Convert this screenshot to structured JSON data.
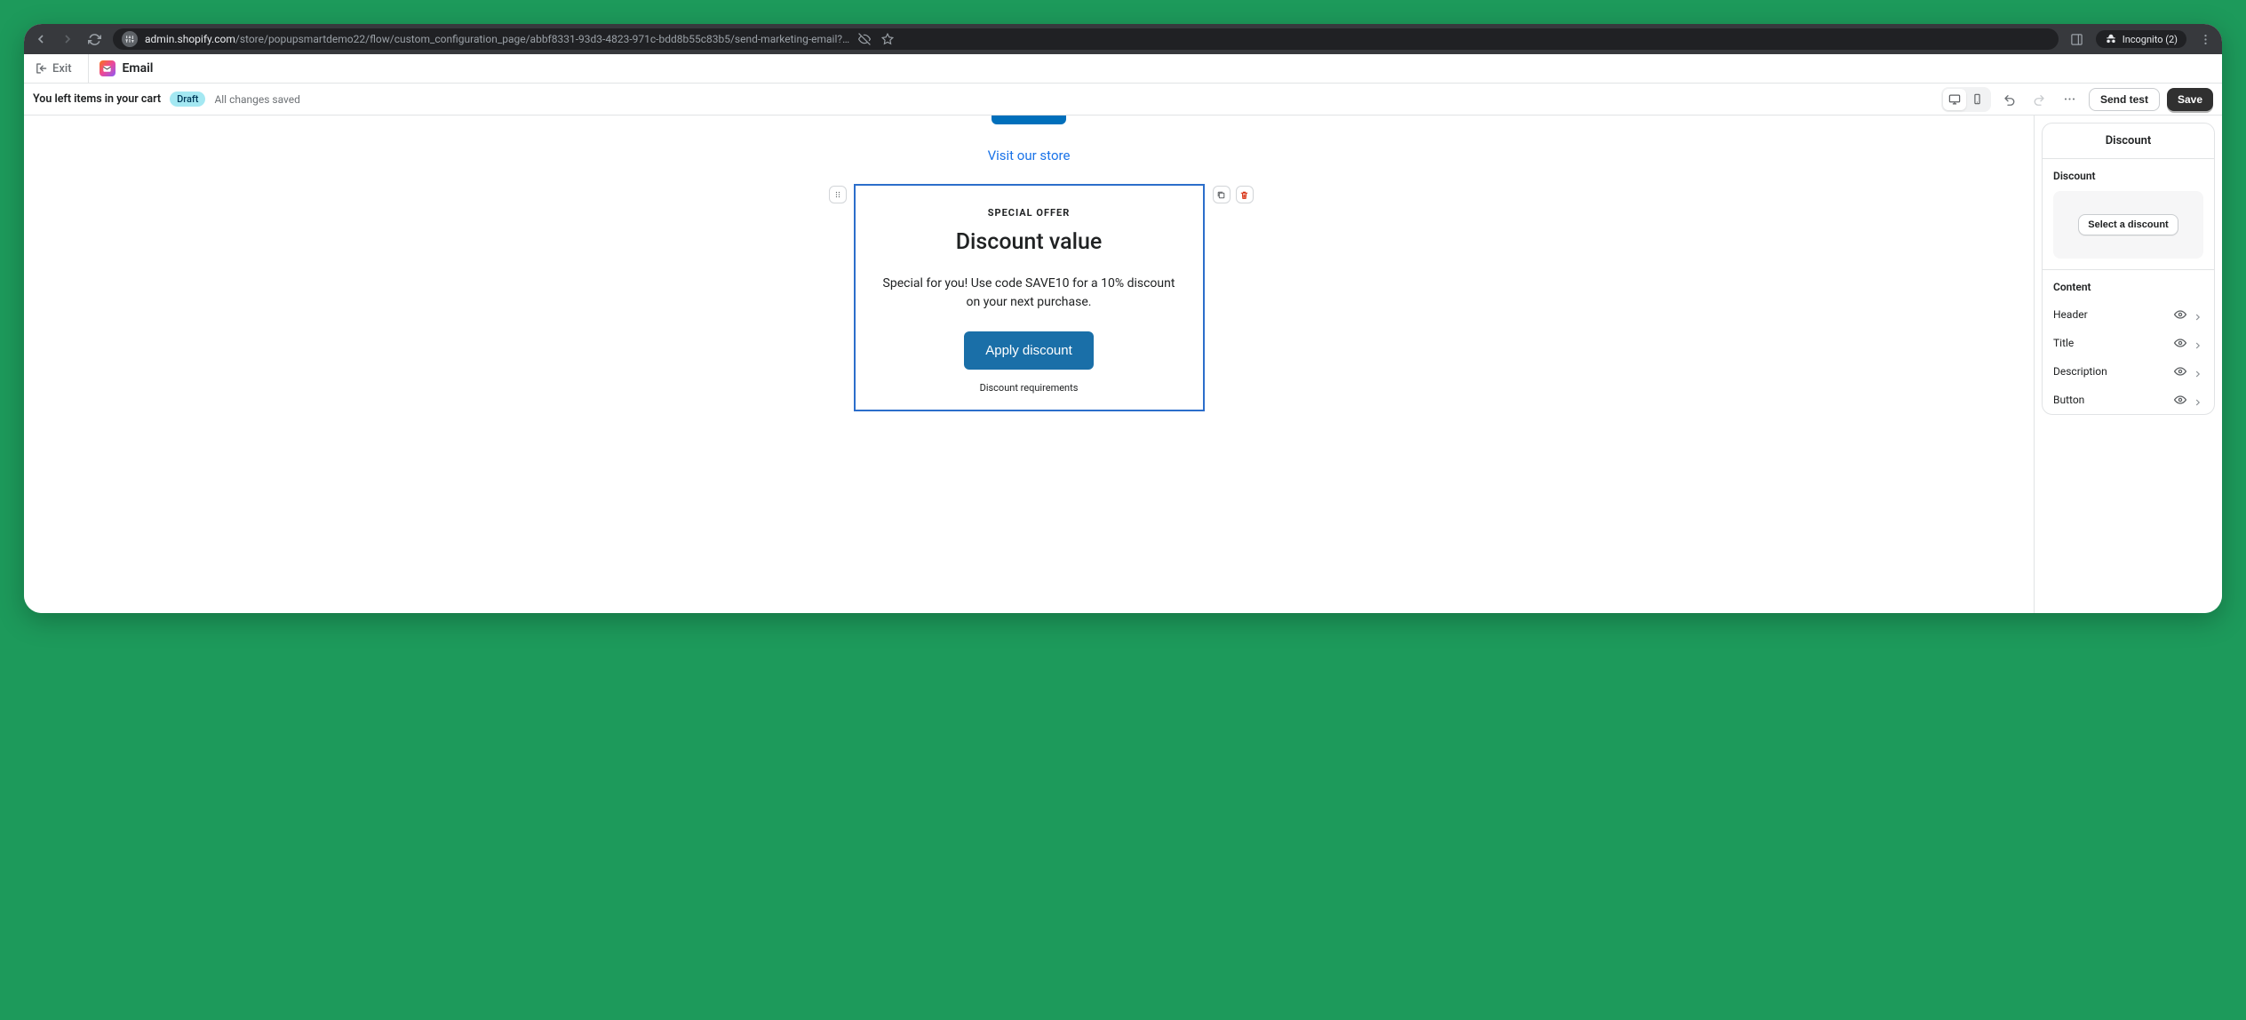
{
  "browser": {
    "url_domain": "admin.shopify.com",
    "url_path": "/store/popupsmartdemo22/flow/custom_configuration_page/abbf8331-93d3-4823-971c-bdd8b55c83b5/send-marketing-email?…",
    "incognito_label": "Incognito (2)"
  },
  "header": {
    "exit": "Exit",
    "app_name": "Email"
  },
  "subheader": {
    "title": "You left items in your cart",
    "badge": "Draft",
    "status": "All changes saved",
    "send_test": "Send test",
    "save": "Save"
  },
  "email": {
    "visit_link": "Visit our store",
    "block": {
      "label": "SPECIAL OFFER",
      "title": "Discount value",
      "description": "Special for you! Use code SAVE10 for a 10% discount on your next purchase.",
      "button": "Apply discount",
      "requirements": "Discount requirements"
    }
  },
  "panel": {
    "title": "Discount",
    "section_discount": "Discount",
    "select_discount": "Select a discount",
    "section_content": "Content",
    "rows": {
      "header": "Header",
      "title": "Title",
      "description": "Description",
      "button": "Button"
    }
  }
}
